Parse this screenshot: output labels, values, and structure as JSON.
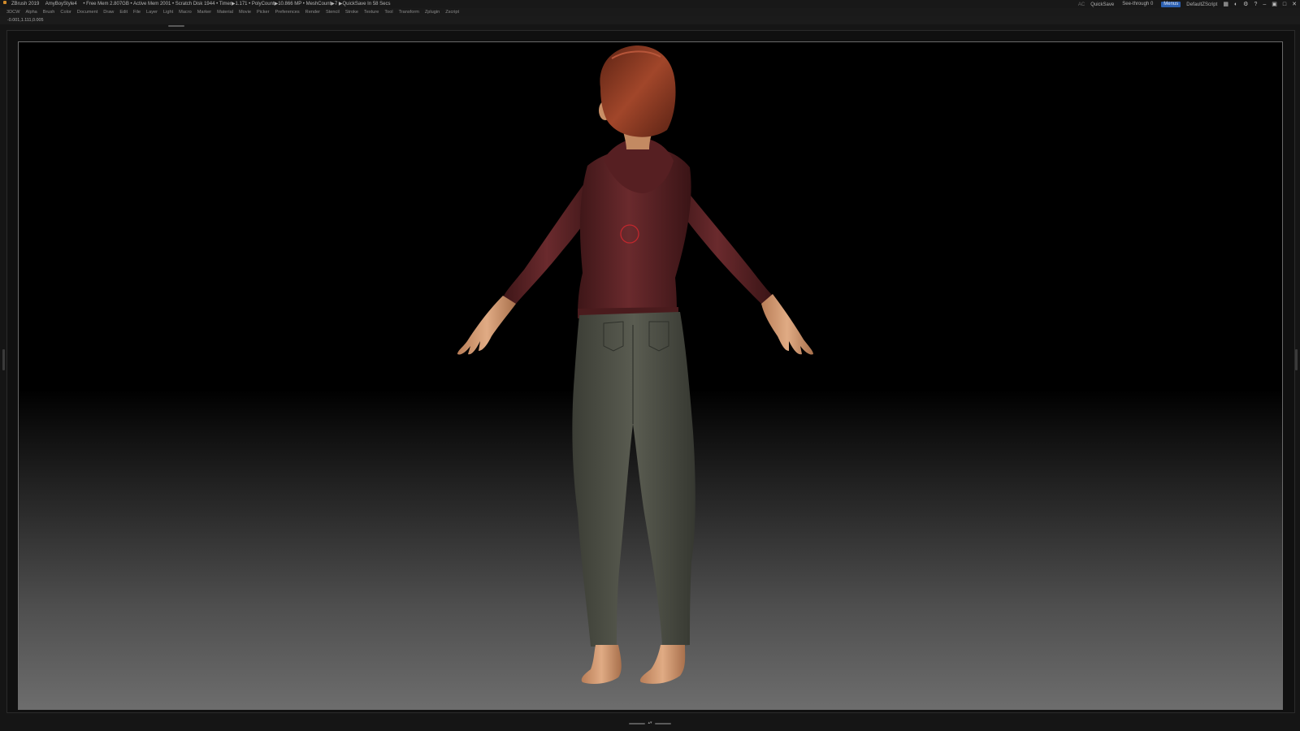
{
  "titlebar": {
    "app_name": "ZBrush 2019",
    "document": "AmyBoyStyle4",
    "stats": "• Free Mem 2.807GB • Active Mem 2001 • Scratch Disk 1944 • Timer▶1.171 • PolyCount▶10.866 MP • MeshCount▶7 ▶QuickSave In 58 Secs",
    "ac_label": "AC",
    "quicksave_label": "QuickSave",
    "see_through_label": "See-through",
    "see_through_value": "0",
    "menus_label": "Menus",
    "default_script": "DefaultZScript"
  },
  "menubar": {
    "items": [
      "3DCW",
      "Alpha",
      "Brush",
      "Color",
      "Document",
      "Draw",
      "Edit",
      "File",
      "Layer",
      "Light",
      "Macro",
      "Marker",
      "Material",
      "Movie",
      "Picker",
      "Preferences",
      "Render",
      "Stencil",
      "Stroke",
      "Texture",
      "Tool",
      "Transform",
      "Zplugin",
      "Zscript"
    ]
  },
  "inforow": {
    "coordinates": "-0.001,1.111,0.005"
  },
  "canvas": {
    "bg_top": "#000000",
    "bg_bottom": "#6d6d6d",
    "subject": "3D character model, back view, A-pose",
    "hoodie_color": "#5a2326",
    "pants_color": "#4b4d43",
    "skin_color": "#d09a72",
    "hair_color": "#8a3a22",
    "brush_cursor_color": "#c0272d"
  }
}
